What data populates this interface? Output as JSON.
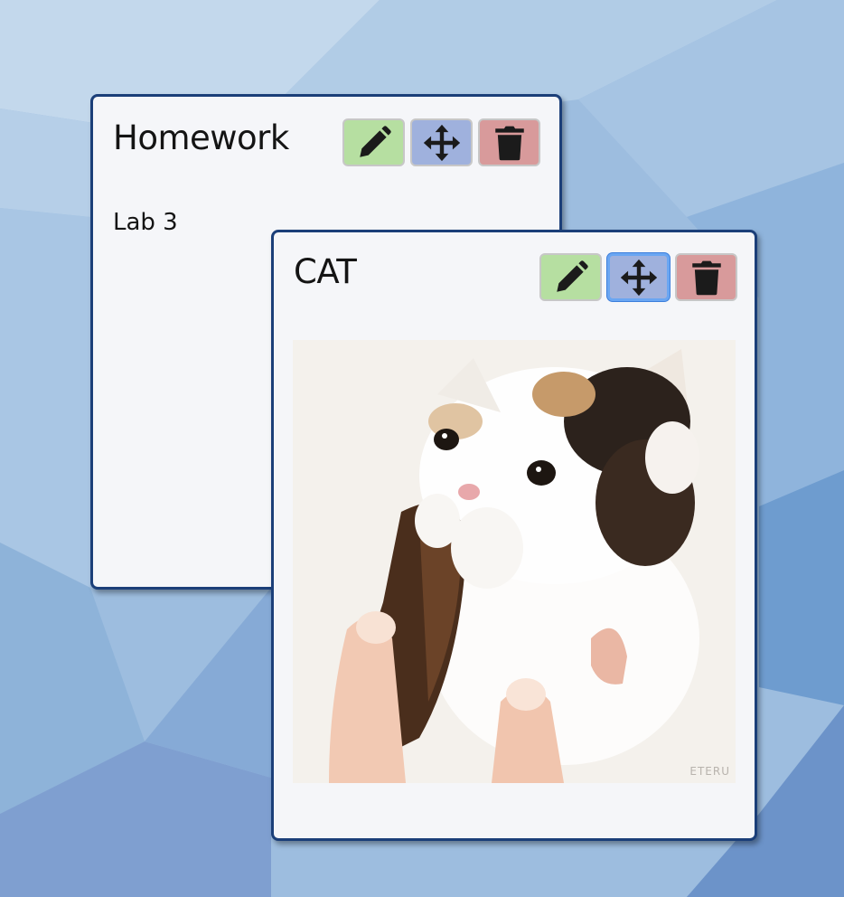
{
  "notes": [
    {
      "title": "Homework",
      "body": "Lab 3",
      "buttons": {
        "edit": "pencil-icon",
        "move": "move-arrows-icon",
        "delete": "trash-icon"
      }
    },
    {
      "title": "CAT",
      "image_watermark": "ETERU",
      "buttons": {
        "edit": "pencil-icon",
        "move": "move-arrows-icon",
        "delete": "trash-icon"
      }
    }
  ],
  "colors": {
    "edit": "#b6dfa1",
    "move": "#9fb1dd",
    "delete": "#d89a9b",
    "border": "#1b3f79",
    "note_bg": "#f5f6f9"
  }
}
